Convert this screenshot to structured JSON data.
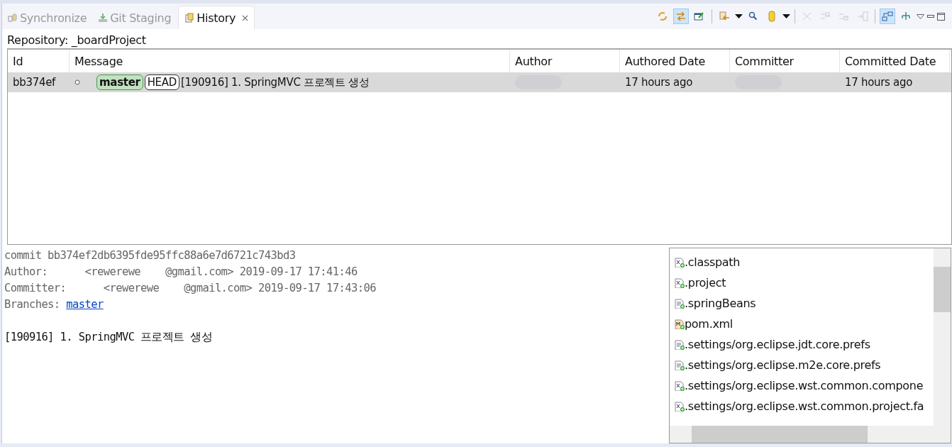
{
  "tabs": [
    {
      "label": "Synchronize",
      "selected": false
    },
    {
      "label": "Git Staging",
      "selected": false
    },
    {
      "label": "History",
      "selected": true,
      "closable": true
    }
  ],
  "toolbar": [
    {
      "kind": "icon",
      "selected": false,
      "disabled": false
    },
    {
      "kind": "icon",
      "selected": true,
      "disabled": false
    },
    {
      "kind": "icon",
      "selected": false,
      "disabled": false
    },
    {
      "kind": "separator"
    },
    {
      "kind": "icon",
      "selected": false,
      "disabled": false
    },
    {
      "kind": "dropdown"
    },
    {
      "kind": "icon",
      "selected": false,
      "disabled": false
    },
    {
      "kind": "icon",
      "selected": false,
      "disabled": false
    },
    {
      "kind": "dropdown"
    },
    {
      "kind": "separator"
    },
    {
      "kind": "icon",
      "selected": false,
      "disabled": true
    },
    {
      "kind": "icon",
      "selected": false,
      "disabled": true
    },
    {
      "kind": "icon",
      "selected": false,
      "disabled": true
    },
    {
      "kind": "icon",
      "selected": false,
      "disabled": true
    },
    {
      "kind": "separator"
    },
    {
      "kind": "icon",
      "selected": true,
      "disabled": false
    },
    {
      "kind": "icon",
      "selected": false,
      "disabled": false
    },
    {
      "kind": "menu"
    },
    {
      "kind": "minimize"
    },
    {
      "kind": "maximize"
    }
  ],
  "repository": "Repository: _boardProject",
  "table": {
    "columns": [
      "Id",
      "Message",
      "Author",
      "Authored Date",
      "Committer",
      "Committed Date"
    ],
    "rows": [
      {
        "selected": true,
        "id": "bb374ef",
        "refs": [
          {
            "label": "master",
            "kind": "branch"
          },
          {
            "label": "HEAD",
            "kind": "head"
          }
        ],
        "message": "[190916] 1. SpringMVC 프로젝트 생성",
        "author_redacted": true,
        "authored_date": "17 hours ago",
        "committer_redacted": true,
        "committed_date": "17 hours ago"
      }
    ]
  },
  "details": {
    "lines": [
      {
        "kind": "text",
        "text": "commit bb374ef2db6395fde95ffc88a6e7d6721c743bd3"
      },
      {
        "kind": "text",
        "text": "Author:      <rewerewe    @gmail.com> 2019-09-17 17:41:46"
      },
      {
        "kind": "text",
        "text": "Committer:      <rewerewe    @gmail.com> 2019-09-17 17:43:06"
      },
      {
        "kind": "link",
        "label": "Branches: ",
        "link": "master"
      },
      {
        "kind": "blank"
      },
      {
        "kind": "message",
        "text": "[190916] 1. SpringMVC 프로젝트 생성"
      }
    ]
  },
  "files": [
    {
      "name": ".classpath",
      "kind": "xml"
    },
    {
      "name": ".project",
      "kind": "xml"
    },
    {
      "name": ".springBeans",
      "kind": "file"
    },
    {
      "name": "pom.xml",
      "kind": "maven"
    },
    {
      "name": ".settings/org.eclipse.jdt.core.prefs",
      "kind": "file"
    },
    {
      "name": ".settings/org.eclipse.m2e.core.prefs",
      "kind": "file"
    },
    {
      "name": ".settings/org.eclipse.wst.common.compone",
      "kind": "xml"
    },
    {
      "name": ".settings/org.eclipse.wst.common.project.fa",
      "kind": "xml"
    }
  ]
}
